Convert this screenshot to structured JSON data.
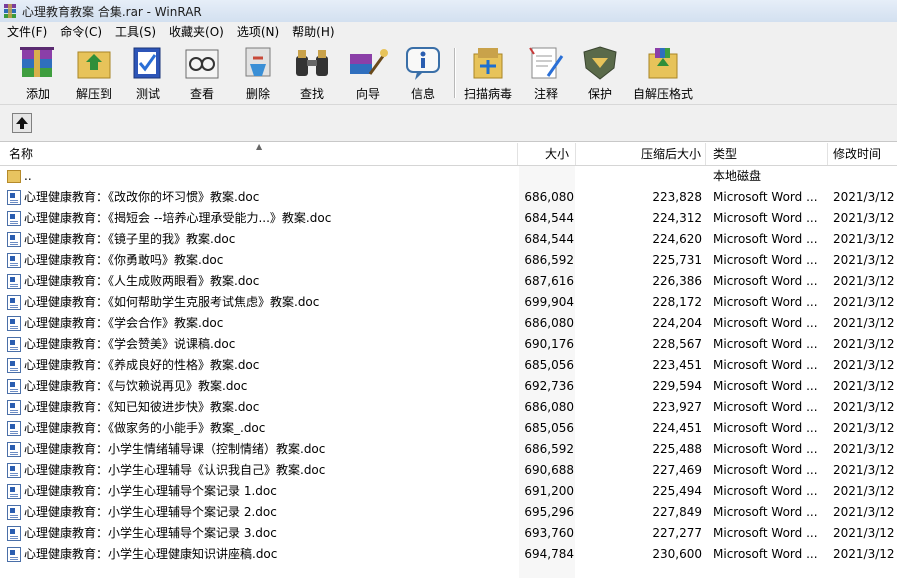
{
  "window": {
    "title": "心理教育教案 合集.rar - WinRAR"
  },
  "menu": [
    "文件(F)",
    "命令(C)",
    "工具(S)",
    "收藏夹(O)",
    "选项(N)",
    "帮助(H)"
  ],
  "toolbar": [
    {
      "label": "添加",
      "icon": "add-icon"
    },
    {
      "label": "解压到",
      "icon": "extract-icon"
    },
    {
      "label": "测试",
      "icon": "test-icon"
    },
    {
      "label": "查看",
      "icon": "view-icon"
    },
    {
      "label": "删除",
      "icon": "delete-icon"
    },
    {
      "label": "查找",
      "icon": "find-icon"
    },
    {
      "label": "向导",
      "icon": "wizard-icon"
    },
    {
      "label": "信息",
      "icon": "info-icon"
    },
    {
      "label": "扫描病毒",
      "icon": "virus-scan-icon"
    },
    {
      "label": "注释",
      "icon": "comment-icon"
    },
    {
      "label": "保护",
      "icon": "protect-icon"
    },
    {
      "label": "自解压格式",
      "icon": "sfx-icon"
    }
  ],
  "columns": {
    "name": "名称",
    "size": "大小",
    "packed": "压缩后大小",
    "type": "类型",
    "modified": "修改时间"
  },
  "parent_row": {
    "name": "..",
    "type": "本地磁盘"
  },
  "files": [
    {
      "name": "心理健康教育：《改改你的坏习惯》教案.doc",
      "size": "686,080",
      "packed": "223,828",
      "type": "Microsoft Word ...",
      "modified": "2021/3/12"
    },
    {
      "name": "心理健康教育：《揭短会 --培养心理承受能力...》教案.doc",
      "size": "684,544",
      "packed": "224,312",
      "type": "Microsoft Word ...",
      "modified": "2021/3/12"
    },
    {
      "name": "心理健康教育：《镜子里的我》教案.doc",
      "size": "684,544",
      "packed": "224,620",
      "type": "Microsoft Word ...",
      "modified": "2021/3/12"
    },
    {
      "name": "心理健康教育：《你勇敢吗》教案.doc",
      "size": "686,592",
      "packed": "225,731",
      "type": "Microsoft Word ...",
      "modified": "2021/3/12"
    },
    {
      "name": "心理健康教育：《人生成败两眼看》教案.doc",
      "size": "687,616",
      "packed": "226,386",
      "type": "Microsoft Word ...",
      "modified": "2021/3/12"
    },
    {
      "name": "心理健康教育：《如何帮助学生克服考试焦虑》教案.doc",
      "size": "699,904",
      "packed": "228,172",
      "type": "Microsoft Word ...",
      "modified": "2021/3/12"
    },
    {
      "name": "心理健康教育：《学会合作》教案.doc",
      "size": "686,080",
      "packed": "224,204",
      "type": "Microsoft Word ...",
      "modified": "2021/3/12"
    },
    {
      "name": "心理健康教育：《学会赞美》说课稿.doc",
      "size": "690,176",
      "packed": "228,567",
      "type": "Microsoft Word ...",
      "modified": "2021/3/12"
    },
    {
      "name": "心理健康教育：《养成良好的性格》教案.doc",
      "size": "685,056",
      "packed": "223,451",
      "type": "Microsoft Word ...",
      "modified": "2021/3/12"
    },
    {
      "name": "心理健康教育：《与饮赖说再见》教案.doc",
      "size": "692,736",
      "packed": "229,594",
      "type": "Microsoft Word ...",
      "modified": "2021/3/12"
    },
    {
      "name": "心理健康教育：《知已知彼进步快》教案.doc",
      "size": "686,080",
      "packed": "223,927",
      "type": "Microsoft Word ...",
      "modified": "2021/3/12"
    },
    {
      "name": "心理健康教育：《做家务的小能手》教案_.doc",
      "size": "685,056",
      "packed": "224,451",
      "type": "Microsoft Word ...",
      "modified": "2021/3/12"
    },
    {
      "name": "心理健康教育：小学生情绪辅导课（控制情绪）教案.doc",
      "size": "686,592",
      "packed": "225,488",
      "type": "Microsoft Word ...",
      "modified": "2021/3/12"
    },
    {
      "name": "心理健康教育：小学生心理辅导《认识我自己》教案.doc",
      "size": "690,688",
      "packed": "227,469",
      "type": "Microsoft Word ...",
      "modified": "2021/3/12"
    },
    {
      "name": "心理健康教育：小学生心理辅导个案记录 1.doc",
      "size": "691,200",
      "packed": "225,494",
      "type": "Microsoft Word ...",
      "modified": "2021/3/12"
    },
    {
      "name": "心理健康教育：小学生心理辅导个案记录 2.doc",
      "size": "695,296",
      "packed": "227,849",
      "type": "Microsoft Word ...",
      "modified": "2021/3/12"
    },
    {
      "name": "心理健康教育：小学生心理辅导个案记录 3.doc",
      "size": "693,760",
      "packed": "227,277",
      "type": "Microsoft Word ...",
      "modified": "2021/3/12"
    },
    {
      "name": "心理健康教育：小学生心理健康知识讲座稿.doc",
      "size": "694,784",
      "packed": "230,600",
      "type": "Microsoft Word ...",
      "modified": "2021/3/12"
    }
  ]
}
